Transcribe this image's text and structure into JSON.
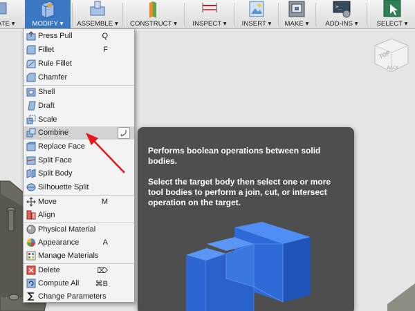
{
  "toolbar": {
    "tabs": [
      {
        "label": "ATE ▾",
        "icon": "create-icon"
      },
      {
        "label": "MODIFY ▾",
        "icon": "modify-icon",
        "active": true
      },
      {
        "label": "ASSEMBLE ▾",
        "icon": "assemble-icon"
      },
      {
        "label": "CONSTRUCT ▾",
        "icon": "construct-icon"
      },
      {
        "label": "INSPECT ▾",
        "icon": "inspect-icon"
      },
      {
        "label": "INSERT ▾",
        "icon": "insert-icon"
      },
      {
        "label": "MAKE ▾",
        "icon": "make-icon"
      },
      {
        "label": "ADD-INS ▾",
        "icon": "add-ins-icon"
      },
      {
        "label": "SELECT ▾",
        "icon": "select-icon"
      }
    ]
  },
  "menu": {
    "items": [
      {
        "label": "Press Pull",
        "shortcut": "Q",
        "icon": "press-pull-icon"
      },
      {
        "label": "Fillet",
        "shortcut": "F",
        "icon": "fillet-icon"
      },
      {
        "label": "Rule Fillet",
        "shortcut": "",
        "icon": "rule-fillet-icon"
      },
      {
        "label": "Chamfer",
        "shortcut": "",
        "icon": "chamfer-icon"
      },
      {
        "label": "Shell",
        "shortcut": "",
        "icon": "shell-icon"
      },
      {
        "label": "Draft",
        "shortcut": "",
        "icon": "draft-icon"
      },
      {
        "label": "Scale",
        "shortcut": "",
        "icon": "scale-icon"
      },
      {
        "label": "Combine",
        "shortcut": "",
        "icon": "combine-icon",
        "highlighted": true
      },
      {
        "label": "Replace Face",
        "shortcut": "",
        "icon": "replace-face-icon"
      },
      {
        "label": "Split Face",
        "shortcut": "",
        "icon": "split-face-icon"
      },
      {
        "label": "Split Body",
        "shortcut": "",
        "icon": "split-body-icon"
      },
      {
        "label": "Silhouette Split",
        "shortcut": "",
        "icon": "silhouette-split-icon"
      },
      {
        "label": "Move",
        "shortcut": "M",
        "icon": "move-icon"
      },
      {
        "label": "Align",
        "shortcut": "",
        "icon": "align-icon"
      },
      {
        "label": "Physical Material",
        "shortcut": "",
        "icon": "physical-material-icon"
      },
      {
        "label": "Appearance",
        "shortcut": "A",
        "icon": "appearance-icon"
      },
      {
        "label": "Manage Materials",
        "shortcut": "",
        "icon": "manage-materials-icon"
      },
      {
        "label": "Delete",
        "shortcut": "⌦",
        "icon": "delete-icon"
      },
      {
        "label": "Compute All",
        "shortcut": "⌘B",
        "icon": "compute-all-icon"
      },
      {
        "label": "Change Parameters",
        "shortcut": "",
        "icon": "change-parameters-icon"
      }
    ]
  },
  "tooltip": {
    "line1": "Performs boolean operations between solid bodies.",
    "line2": "Select the target body then select one or more tool bodies to perform a join, cut, or intersect operation on the target."
  },
  "viewcube": {
    "face_top": "TOP",
    "face_back": "BACK"
  },
  "colors": {
    "accent": "#3b78c4",
    "tooltip_bg": "#4e4e4e",
    "body_blue": "#2f6fe0",
    "annotation_arrow": "#e8151b"
  }
}
